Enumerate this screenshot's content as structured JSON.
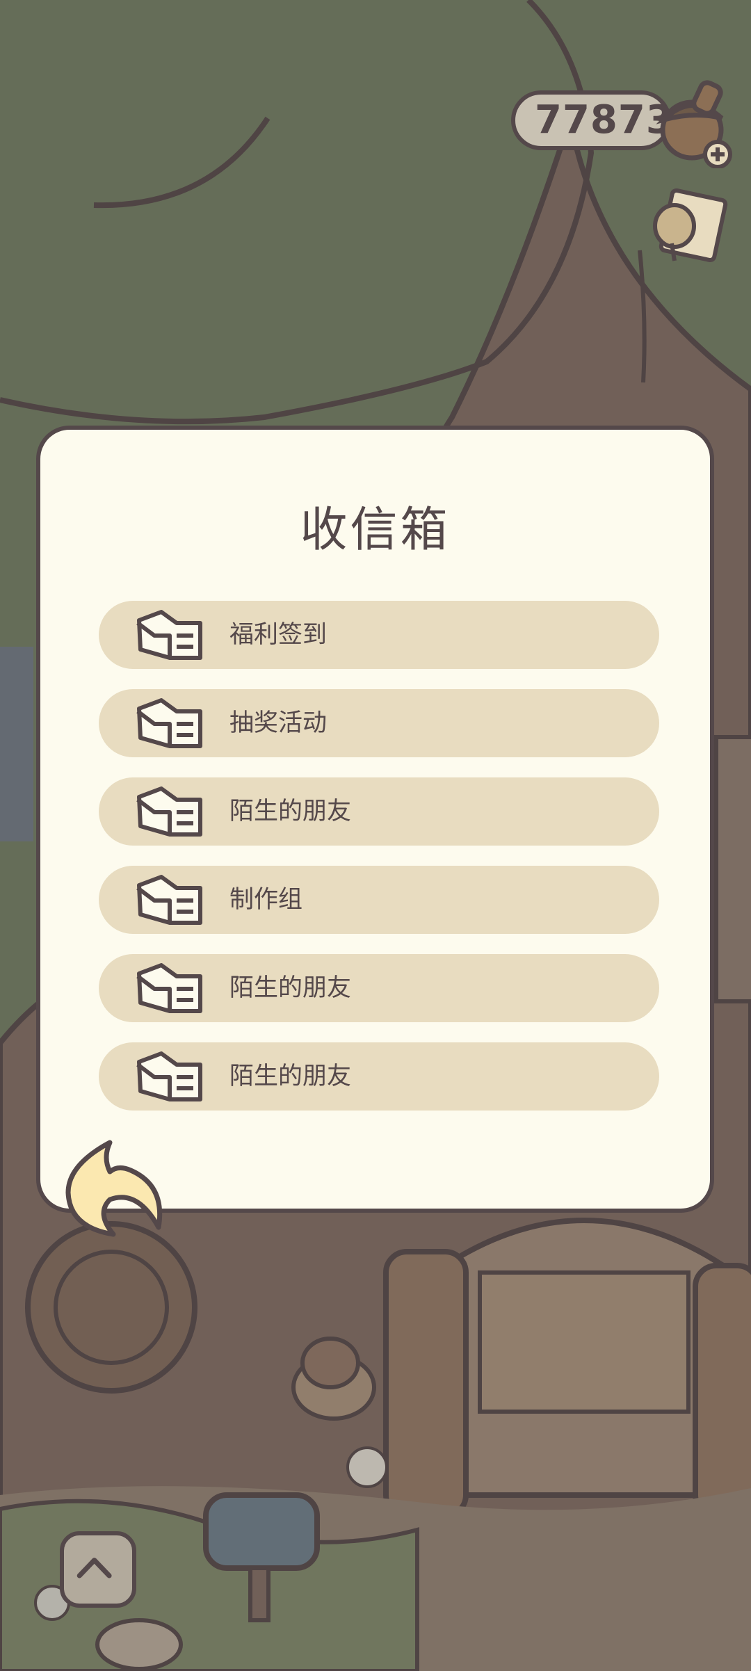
{
  "currency": {
    "amount": "77873"
  },
  "inbox": {
    "title": "收信箱",
    "items": [
      {
        "label": "福利签到"
      },
      {
        "label": "抽奖活动"
      },
      {
        "label": "陌生的朋友"
      },
      {
        "label": "制作组"
      },
      {
        "label": "陌生的朋友"
      },
      {
        "label": "陌生的朋友"
      }
    ]
  },
  "colors": {
    "outline": "#54484a",
    "modal_bg": "#fdfbee",
    "item_bg": "#e8dcc0",
    "foliage": "#6e7a62",
    "trunk": "#7d6b62"
  },
  "icons": [
    "acorn-icon",
    "plus-icon",
    "ticket-icon",
    "letter-icon",
    "back-arrow-icon",
    "chevron-up-icon",
    "mailbox-icon"
  ]
}
